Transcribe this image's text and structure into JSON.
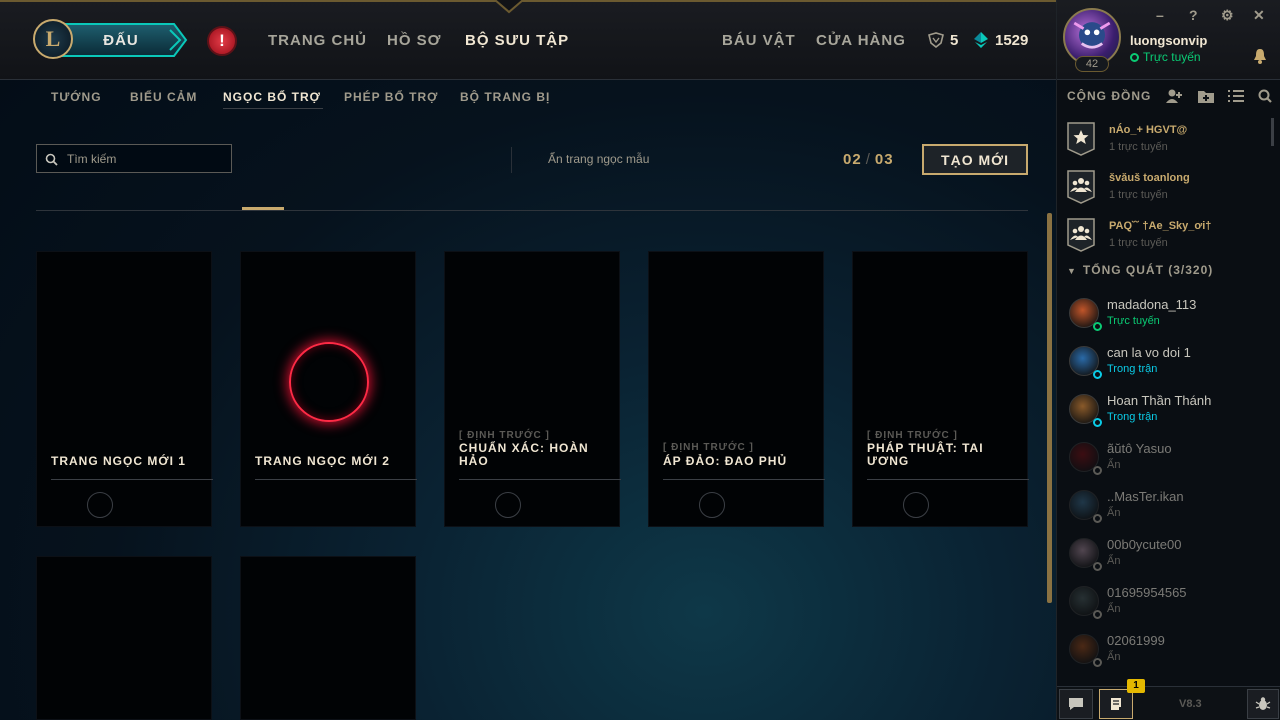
{
  "header": {
    "logo_text": "L",
    "play_label": "ĐẤU",
    "alert_symbol": "!",
    "nav": [
      "TRANG CHỦ",
      "HỒ SƠ",
      "BỘ SƯU TẬP"
    ],
    "nav_right": [
      "BÁU VẬT",
      "CỬA HÀNG"
    ],
    "active_nav": "BỘ SƯU TẬP",
    "orange_essence": "5",
    "riot_points": "1529"
  },
  "profile": {
    "username": "luongsonvip",
    "status": "Trực tuyến",
    "level": "42",
    "window_buttons": [
      "–",
      "?",
      "⚙",
      "✕"
    ]
  },
  "subnav": {
    "items": [
      "TƯỚNG",
      "BIỂU CẢM",
      "NGỌC BỔ TRỢ",
      "PHÉP BỔ TRỢ",
      "BỘ TRANG BỊ"
    ],
    "active": "NGỌC BỔ TRỢ"
  },
  "toolbar": {
    "search_placeholder": "Tìm kiếm",
    "hide_toggle_label": "Ẩn trang ngọc mẫu",
    "page_current": "02",
    "page_sep": "/",
    "page_total": "03",
    "create_label": "TẠO MỚI"
  },
  "cards": [
    {
      "tag": "",
      "title": "TRANG NGỌC MỚI 1"
    },
    {
      "tag": "",
      "title": "TRANG NGỌC MỚI 2",
      "selected": true
    },
    {
      "tag": "[ ĐỊNH TRƯỚC ]",
      "title": "CHUẨN XÁC: HOÀN HẢO"
    },
    {
      "tag": "[ ĐỊNH TRƯỚC ]",
      "title": "ÁP ĐẢO: ĐAO PHỦ"
    },
    {
      "tag": "[ ĐỊNH TRƯỚC ]",
      "title": "PHÁP THUẬT: TAI ƯƠNG"
    },
    {
      "tag": "",
      "title": ""
    },
    {
      "tag": "",
      "title": ""
    }
  ],
  "social": {
    "title": "CỘNG ĐỒNG",
    "groups": [
      {
        "name": "nÁo_+ HGVT@",
        "status": "1 trực tuyến",
        "icon": "star-icon"
      },
      {
        "name": "švăuš toanlong",
        "status": "1 trực tuyến",
        "icon": "group-icon"
      },
      {
        "name": "PAQ˘˘ †Ae_Sky_ơi†",
        "status": "1 trực tuyến",
        "icon": "group-icon"
      }
    ],
    "section_label": "TỔNG QUÁT (3/320)",
    "friends": [
      {
        "name": "madadona_113",
        "status": "Trực tuyến",
        "state": "online",
        "color": "#c0552a"
      },
      {
        "name": "can la vo doi 1",
        "status": "Trong trận",
        "state": "ingame",
        "color": "#2a6aa8"
      },
      {
        "name": "Hoan Thần Thánh",
        "status": "Trong trận",
        "state": "ingame",
        "color": "#8a5a2a"
      },
      {
        "name": "ãŭtô Yasuo",
        "status": "Ẩn",
        "state": "away",
        "color": "#7a0d12"
      },
      {
        "name": "..MasTer.ikan",
        "status": "Ẩn",
        "state": "away",
        "color": "#3a6a8a"
      },
      {
        "name": "00b0ycute00",
        "status": "Ẩn",
        "state": "away",
        "color": "#a88a9a"
      },
      {
        "name": "01695954565",
        "status": "Ẩn",
        "state": "away",
        "color": "#4a5a5a"
      },
      {
        "name": "02061999",
        "status": "Ẩn",
        "state": "away",
        "color": "#9a4a1a"
      }
    ],
    "notification_count": "1",
    "version": "V8.3"
  },
  "colors": {
    "gold": "#c8aa6e",
    "online": "#0acb74",
    "ingame": "#0acbe6",
    "away": "#5b5a56",
    "selected_ring": "#ff2a45"
  }
}
